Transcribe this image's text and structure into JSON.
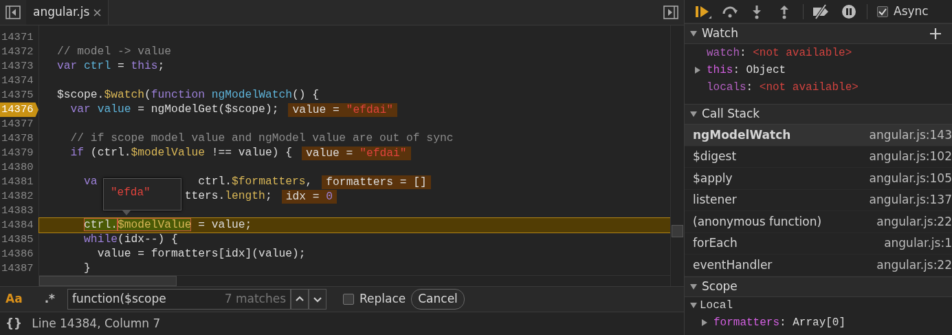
{
  "tab": {
    "title": "angular.js"
  },
  "lines": [
    {
      "number": "14371"
    },
    {
      "number": "14372",
      "tokens": [
        {
          "text": "// model -> value",
          "kind": "comment"
        }
      ]
    },
    {
      "number": "14373",
      "tokens": [
        {
          "text": "var",
          "kind": "keyword"
        },
        {
          "text": " ctrl",
          "kind": "variable"
        },
        {
          "text": " = ",
          "kind": "plain"
        },
        {
          "text": "this",
          "kind": "keyword"
        },
        {
          "text": ";",
          "kind": "plain"
        }
      ]
    },
    {
      "number": "14374"
    },
    {
      "number": "14375",
      "tokens": [
        {
          "text": "$scope.",
          "kind": "plain"
        },
        {
          "text": "$watch",
          "kind": "property"
        },
        {
          "text": "(",
          "kind": "plain"
        },
        {
          "text": "function",
          "kind": "keyword"
        },
        {
          "text": " ngModelWatch",
          "kind": "variable"
        },
        {
          "text": "() {",
          "kind": "plain"
        }
      ]
    },
    {
      "number": "14376",
      "breakpoint": true,
      "tokens": [
        {
          "text": "  var",
          "kind": "keyword"
        },
        {
          "text": " value",
          "kind": "variable"
        },
        {
          "text": " = ngModelGet($scope);",
          "kind": "plain"
        }
      ],
      "inline_value": [
        {
          "text": "value = ",
          "kind": "plain"
        },
        {
          "text": "\"efdai\"",
          "kind": "string"
        }
      ]
    },
    {
      "number": "14377"
    },
    {
      "number": "14378",
      "tokens": [
        {
          "text": "  // if scope model value and ngModel value are out of sync",
          "kind": "comment"
        }
      ]
    },
    {
      "number": "14379",
      "tokens": [
        {
          "text": "  if",
          "kind": "keyword"
        },
        {
          "text": " (ctrl.",
          "kind": "plain"
        },
        {
          "text": "$modelValue",
          "kind": "property"
        },
        {
          "text": " !== value) {",
          "kind": "plain"
        }
      ],
      "inline_value": [
        {
          "text": "value = ",
          "kind": "plain"
        },
        {
          "text": "\"efdai\"",
          "kind": "string"
        }
      ]
    },
    {
      "number": "14380"
    },
    {
      "number": "14381",
      "tokens": [
        {
          "text": "    va",
          "kind": "keyword"
        },
        {
          "text": "               ctrl.",
          "kind": "plain"
        },
        {
          "text": "$formatters",
          "kind": "property"
        },
        {
          "text": ",",
          "kind": "plain"
        }
      ],
      "inline_value": [
        {
          "text": "formatters = []",
          "kind": "plain"
        }
      ]
    },
    {
      "number": "14382",
      "tokens": [
        {
          "text": "                   tters.",
          "kind": "plain"
        },
        {
          "text": "length",
          "kind": "property"
        },
        {
          "text": ";",
          "kind": "plain"
        }
      ],
      "inline_value": [
        {
          "text": "idx = ",
          "kind": "plain"
        },
        {
          "text": "0",
          "kind": "number"
        }
      ]
    },
    {
      "number": "14383"
    },
    {
      "number": "14384",
      "current": true,
      "tokens": [
        {
          "text": "    ctrl.",
          "kind": "plain",
          "hovered": true
        },
        {
          "text": "$modelValue",
          "kind": "property",
          "hovered": true
        },
        {
          "text": " = value;",
          "kind": "plain"
        }
      ]
    },
    {
      "number": "14385",
      "tokens": [
        {
          "text": "    while",
          "kind": "keyword"
        },
        {
          "text": "(idx--) {",
          "kind": "plain"
        }
      ]
    },
    {
      "number": "14386",
      "tokens": [
        {
          "text": "      value = formatters[idx](value);",
          "kind": "plain"
        }
      ]
    },
    {
      "number": "14387",
      "tokens": [
        {
          "text": "    }",
          "kind": "plain"
        }
      ]
    }
  ],
  "tooltip": {
    "text": "\"efda\""
  },
  "find_bar": {
    "match_case": {
      "label": "Aa",
      "on": true
    },
    "regex": {
      "label": ".*",
      "on": false
    },
    "query": "function($scope",
    "matches": "7 matches",
    "replace": {
      "label": "Replace",
      "checked": false
    },
    "cancel": "Cancel"
  },
  "status_bar": {
    "format_label": "{}",
    "position": "Line 14384, Column 7"
  },
  "debugger": {
    "async": {
      "label": "Async",
      "checked": true
    },
    "watch": {
      "title": "Watch",
      "expanded": true,
      "items": [
        {
          "expandable": false,
          "tokens": [
            {
              "text": "watch",
              "kind": "name"
            },
            {
              "text": ": ",
              "kind": "plain"
            },
            {
              "text": "<not available>",
              "kind": "error"
            }
          ]
        },
        {
          "expandable": true,
          "tokens": [
            {
              "text": "this",
              "kind": "own-name"
            },
            {
              "text": ": Object",
              "kind": "plain"
            }
          ]
        },
        {
          "expandable": false,
          "tokens": [
            {
              "text": "locals",
              "kind": "name"
            },
            {
              "text": ": ",
              "kind": "plain"
            },
            {
              "text": "<not available>",
              "kind": "error"
            }
          ]
        }
      ]
    },
    "call_stack": {
      "title": "Call Stack",
      "expanded": true,
      "frames": [
        {
          "function": "ngModelWatch",
          "location": "angular.js:143",
          "selected": true
        },
        {
          "function": "$digest",
          "location": "angular.js:102",
          "selected": false
        },
        {
          "function": "$apply",
          "location": "angular.js:105",
          "selected": false
        },
        {
          "function": "listener",
          "location": "angular.js:137",
          "selected": false
        },
        {
          "function": "(anonymous function)",
          "location": "angular.js:22",
          "selected": false
        },
        {
          "function": "forEach",
          "location": "angular.js:1",
          "selected": false
        },
        {
          "function": "eventHandler",
          "location": "angular.js:22",
          "selected": false
        }
      ]
    },
    "scope": {
      "title": "Scope",
      "expanded": true,
      "groups": [
        {
          "label": "Local",
          "expanded": true,
          "items": [
            {
              "expandable": true,
              "tokens": [
                {
                  "text": "formatters",
                  "kind": "own-name"
                },
                {
                  "text": ": Array[0]",
                  "kind": "plain"
                }
              ]
            }
          ]
        }
      ]
    }
  }
}
